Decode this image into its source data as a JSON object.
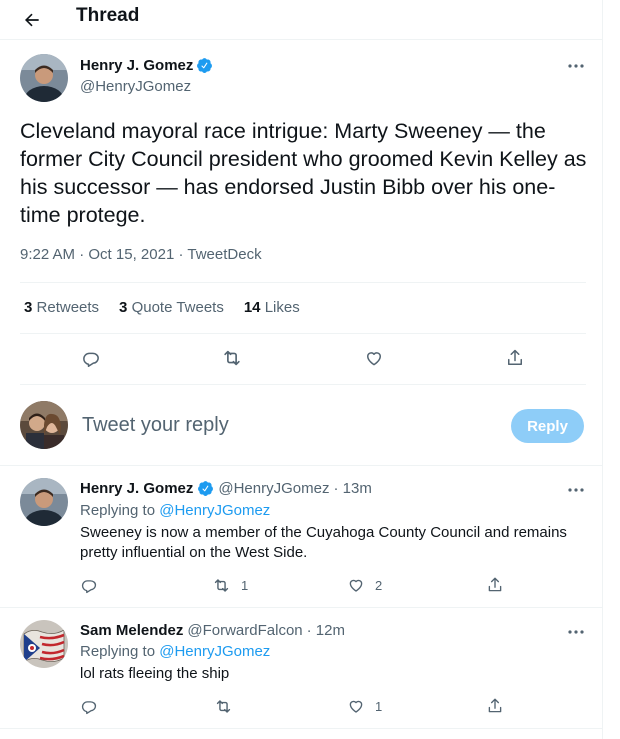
{
  "header": {
    "title": "Thread",
    "back_icon": "arrow-left-icon"
  },
  "main_tweet": {
    "author_name": "Henry J. Gomez",
    "author_handle": "@HenryJGomez",
    "verified": true,
    "text": "Cleveland mayoral race intrigue: Marty Sweeney — the former City Council president who groomed Kevin Kelley as his successor — has endorsed Justin Bibb over his one-time protege.",
    "time": "9:22 AM",
    "date": "Oct 15, 2021",
    "source": "TweetDeck",
    "meta_separator": "·",
    "stats": {
      "retweets_count": "3",
      "retweets_label": "Retweets",
      "quotes_count": "3",
      "quotes_label": "Quote Tweets",
      "likes_count": "14",
      "likes_label": "Likes"
    }
  },
  "composer": {
    "placeholder": "Tweet your reply",
    "reply_label": "Reply"
  },
  "replies": [
    {
      "author_name": "Henry J. Gomez",
      "verified": true,
      "author_handle": "@HenryJGomez",
      "time_ago": "· 13m",
      "replying_to_prefix": "Replying to",
      "replying_to_handle": "@HenryJGomez",
      "text": "Sweeney is now a member of the Cuyahoga County Council and remains pretty influential on the West Side.",
      "retweet_count": "1",
      "like_count": "2"
    },
    {
      "author_name": "Sam Melendez",
      "verified": false,
      "author_handle": "@ForwardFalcon",
      "time_ago": "· 12m",
      "replying_to_prefix": "Replying to",
      "replying_to_handle": "@HenryJGomez",
      "text": "lol rats fleeing the ship",
      "retweet_count": "",
      "like_count": "1"
    }
  ],
  "colors": {
    "accent": "#1d9bf0",
    "reply_button_disabled": "#8ecdf8",
    "secondary_text": "#536471",
    "divider": "#eff3f4"
  }
}
